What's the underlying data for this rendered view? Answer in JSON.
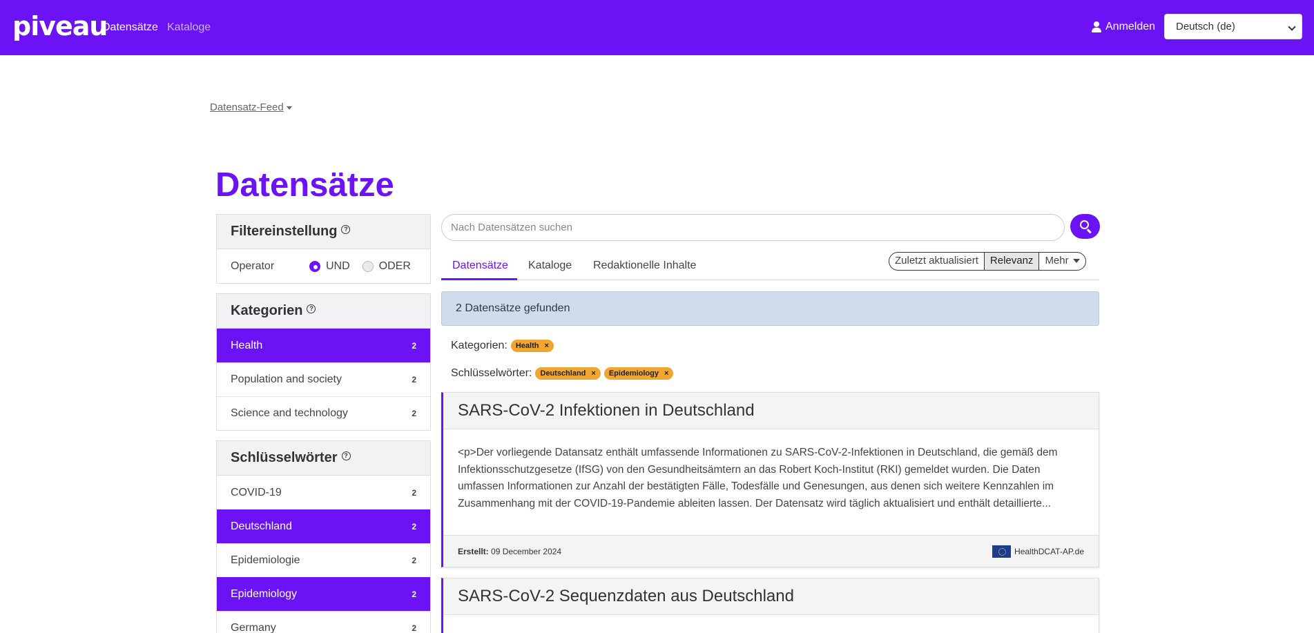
{
  "header": {
    "logo": "piveau",
    "nav": [
      "Datensätze",
      "Kataloge"
    ],
    "login": "Anmelden",
    "language": "Deutsch (de)"
  },
  "feed": "Datensatz-Feed",
  "page_title": "Datensätze",
  "filter_settings": {
    "title": "Filtereinstellung",
    "operator_label": "Operator",
    "options": [
      "UND",
      "ODER"
    ],
    "selected": "UND"
  },
  "categories": {
    "title": "Kategorien",
    "items": [
      {
        "label": "Health",
        "count": "2",
        "active": true
      },
      {
        "label": "Population and society",
        "count": "2",
        "active": false
      },
      {
        "label": "Science and technology",
        "count": "2",
        "active": false
      }
    ]
  },
  "keywords": {
    "title": "Schlüsselwörter",
    "items": [
      {
        "label": "COVID-19",
        "count": "2",
        "active": false
      },
      {
        "label": "Deutschland",
        "count": "2",
        "active": true
      },
      {
        "label": "Epidemiologie",
        "count": "2",
        "active": false
      },
      {
        "label": "Epidemiology",
        "count": "2",
        "active": true
      },
      {
        "label": "Germany",
        "count": "2",
        "active": false
      }
    ]
  },
  "search": {
    "placeholder": "Nach Datensätzen suchen"
  },
  "tabs": [
    "Datensätze",
    "Kataloge",
    "Redaktionelle Inhalte"
  ],
  "sort": {
    "options": [
      "Zuletzt aktualisiert",
      "Relevanz",
      "Mehr"
    ],
    "selected": "Relevanz"
  },
  "results_banner": "2 Datensätze gefunden",
  "active_filters": {
    "categories_label": "Kategorien:",
    "categories": [
      "Health"
    ],
    "keywords_label": "Schlüsselwörter:",
    "keywords": [
      "Deutschland",
      "Epidemiology"
    ],
    "remove_symbol": "×"
  },
  "datasets": [
    {
      "title": "SARS-CoV-2 Infektionen in Deutschland",
      "description": "<p>Der vorliegende Datansatz enthält umfassende Informationen zu SARS-CoV-2-Infektionen in Deutschland, die gemäß dem Infektionsschutzgesetze (IfSG) von den Gesundheitsämtern an das Robert Koch-Institut (RKI) gemeldet wurden. Die Daten umfassen Informationen zur Anzahl der bestätigten Fälle, Todesfälle und Genesungen, aus denen sich weitere Kennzahlen im Zusammenhang mit der COVID-19-Pandemie ableiten lassen. Der Datensatz wird täglich aktualisiert und enthält detaillierte...",
      "created_label": "Erstellt:",
      "created": "09 December 2024",
      "catalog": "HealthDCAT-AP.de"
    },
    {
      "title": "SARS-CoV-2 Sequenzdaten aus Deutschland"
    }
  ]
}
